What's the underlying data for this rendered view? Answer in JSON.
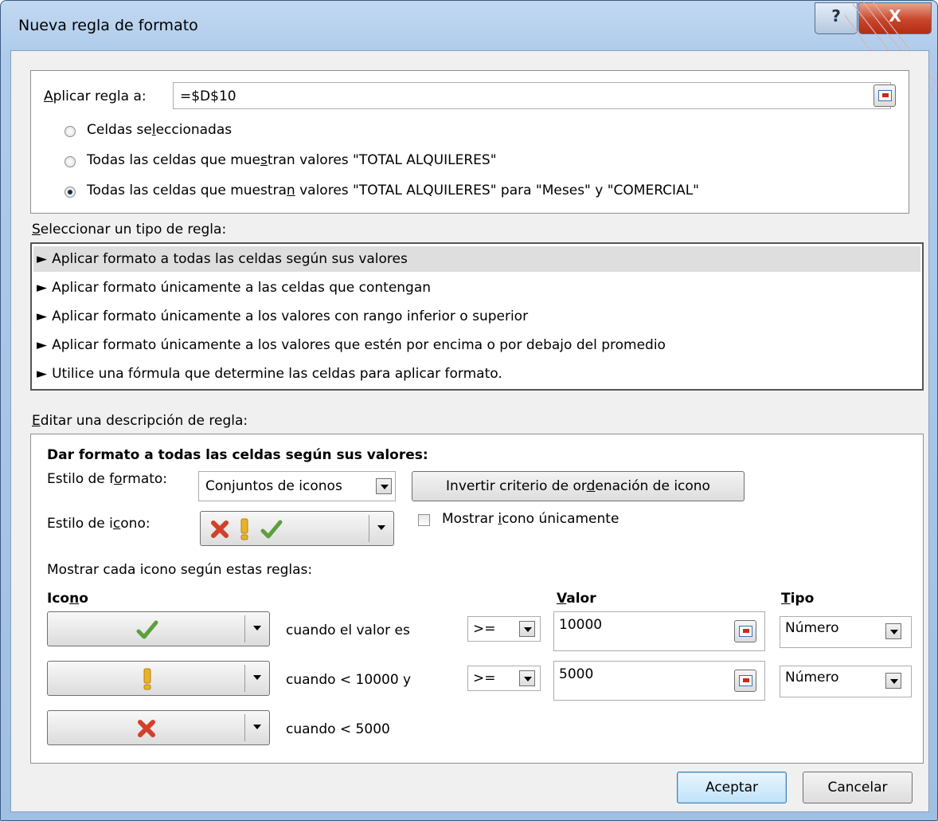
{
  "window": {
    "title": "Nueva regla de formato",
    "help_glyph": "?",
    "close_glyph": "X"
  },
  "apply": {
    "label_first": "A",
    "label_rest": "plicar regla a:",
    "value": "=$D$10",
    "radios": [
      {
        "pre": "Celdas se",
        "ul": "l",
        "post": "eccionadas",
        "selected": false
      },
      {
        "pre": "Todas las celdas que mue",
        "ul": "s",
        "post": "tran valores \"TOTAL ALQUILERES\"",
        "selected": false
      },
      {
        "pre": "Todas las celdas que muestra",
        "ul": "n",
        "post": " valores \"TOTAL ALQUILERES\" para \"Meses\" y \"COMERCIAL\"",
        "selected": true
      }
    ]
  },
  "rule_type": {
    "label_first": "S",
    "label_rest": "eleccionar un tipo de regla:",
    "arrow": "►",
    "items": [
      "Aplicar formato a todas las celdas según sus valores",
      "Aplicar formato únicamente a las celdas que contengan",
      "Aplicar formato únicamente a los valores con rango inferior o superior",
      "Aplicar formato únicamente a los valores que estén por encima o por debajo del promedio",
      "Utilice una fórmula que determine las celdas para aplicar formato."
    ],
    "selected_index": 0
  },
  "edit": {
    "label_first": "E",
    "label_rest": "ditar una descripción de regla:",
    "heading": "Dar formato a todas las celdas según sus valores:",
    "format_style_pre": "Estilo de f",
    "format_style_ul": "o",
    "format_style_post": "rmato:",
    "format_style_value": "Conjuntos de iconos",
    "reverse_pre": "Invertir criterio de or",
    "reverse_ul": "d",
    "reverse_post": "enación de icono",
    "icon_style_pre": "Estilo de i",
    "icon_style_ul": "c",
    "icon_style_post": "ono:",
    "show_icon_pre": "Mostrar ",
    "show_icon_ul": "i",
    "show_icon_post": "cono únicamente",
    "show_icon_checked": false,
    "rules_heading": "Mostrar cada icono según estas reglas:",
    "col_icon_pre": "Ico",
    "col_icon_ul": "n",
    "col_icon_post": "o",
    "col_value_ul": "V",
    "col_value_post": "alor",
    "col_type_ul": "T",
    "col_type_post": "ipo",
    "rows": [
      {
        "icon": "green-check",
        "condition": "cuando el valor es",
        "operator": ">=",
        "value": "10000",
        "type": "Número"
      },
      {
        "icon": "yellow-exclamation",
        "condition": "cuando < 10000 y",
        "operator": ">=",
        "value": "5000",
        "type": "Número"
      },
      {
        "icon": "red-x",
        "condition": "cuando < 5000"
      }
    ]
  },
  "buttons": {
    "ok": "Aceptar",
    "cancel": "Cancelar"
  },
  "colors": {
    "check_green": "#5d9f3c",
    "warn_yellow": "#e8b22a",
    "x_red": "#d3402a"
  }
}
